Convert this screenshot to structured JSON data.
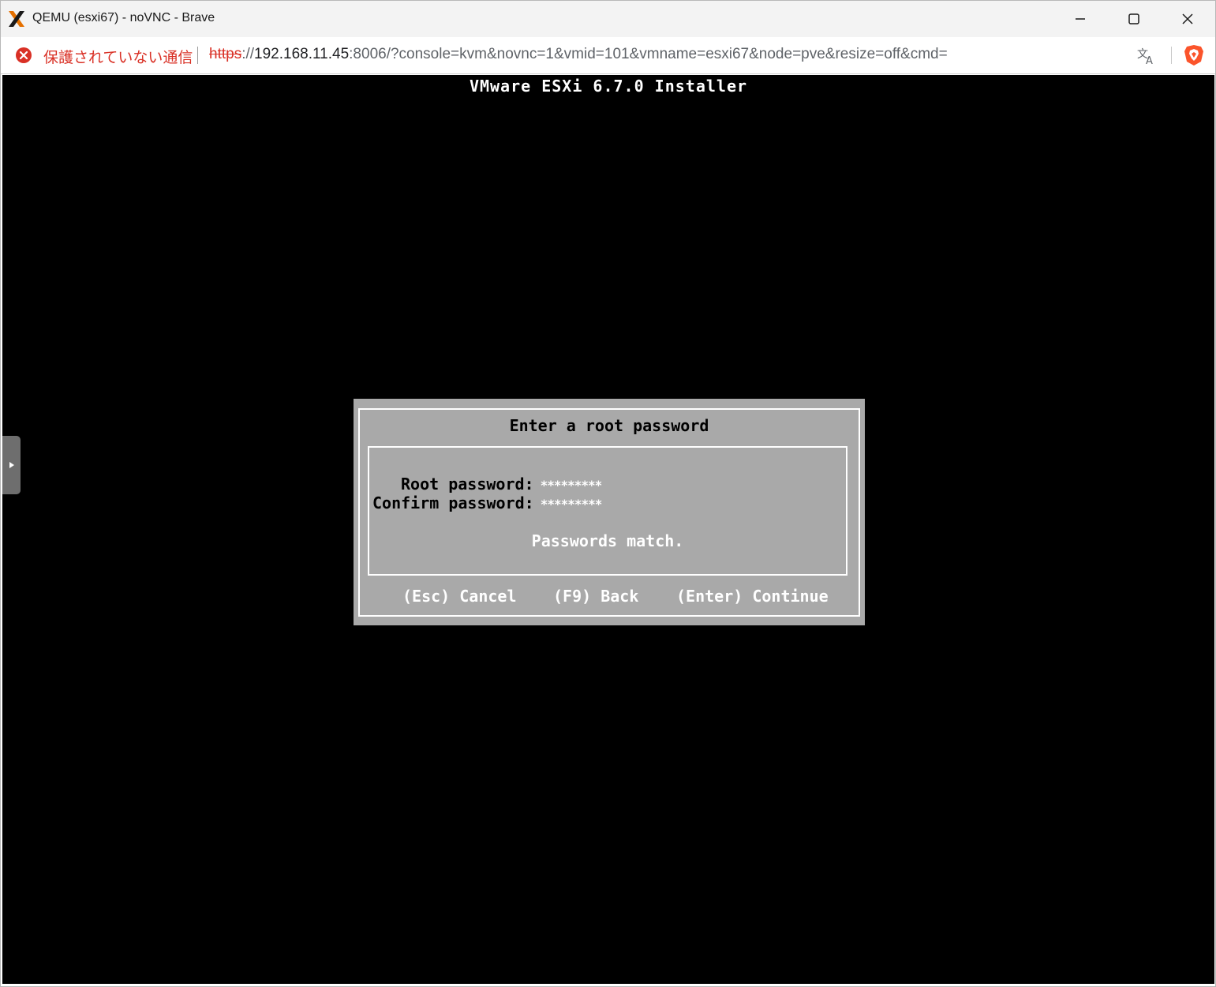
{
  "window": {
    "title": "QEMU (esxi67) - noVNC - Brave",
    "app_icon": "proxmox-x-icon",
    "controls": [
      "minimize-icon",
      "maximize-icon",
      "close-icon"
    ]
  },
  "addressbar": {
    "security_label": "保護されていない通信",
    "url_scheme": "https",
    "url_separator": "://",
    "url_host": "192.168.11.45",
    "url_rest": ":8006/?console=kvm&novnc=1&vmid=101&vmname=esxi67&node=pve&resize=off&cmd=",
    "icons": [
      "not-secure-icon",
      "translate-icon",
      "brave-shields-icon"
    ]
  },
  "console": {
    "installer_title": "VMware ESXi 6.7.0 Installer",
    "dialog": {
      "title": "Enter a root password",
      "root_label": "Root password:",
      "root_value": "*********",
      "confirm_label": "Confirm password:",
      "confirm_value": "*********",
      "status": "Passwords match.",
      "actions": {
        "cancel": "(Esc) Cancel",
        "back": "(F9) Back",
        "continue": "(Enter) Continue"
      }
    }
  },
  "colors": {
    "dialog_bg": "#a9a9a9",
    "console_bg": "#000000",
    "insecure_red": "#d93025",
    "brave_orange": "#fb542b"
  }
}
